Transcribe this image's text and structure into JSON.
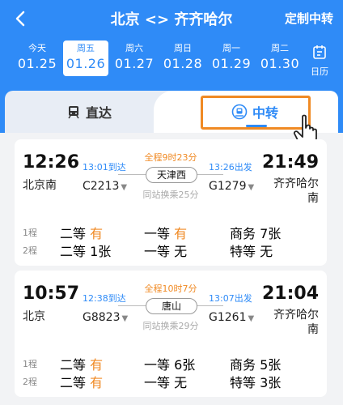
{
  "header": {
    "title": "北京 <> 齐齐哈尔",
    "custom_label": "定制中转",
    "calendar_label": "日历"
  },
  "dates": [
    {
      "weekday": "今天",
      "date": "01.25"
    },
    {
      "weekday": "周五",
      "date": "01.26",
      "selected": true
    },
    {
      "weekday": "周六",
      "date": "01.27"
    },
    {
      "weekday": "周日",
      "date": "01.28"
    },
    {
      "weekday": "周一",
      "date": "01.29"
    },
    {
      "weekday": "周二",
      "date": "01.30"
    }
  ],
  "tabs": {
    "direct": "直达",
    "transfer": "中转"
  },
  "trips": [
    {
      "dep_time": "12:26",
      "dep_station": "北京南",
      "arr_time": "21:49",
      "arr_station": "齐齐哈尔南",
      "first_arrive": "13:01到达",
      "second_depart": "13:26出发",
      "duration": "全程9时23分",
      "transfer_station": "天津西",
      "train1": "C2213",
      "train2": "G1279",
      "transfer_note": "同站换乘25分",
      "seats": [
        {
          "leg": "1程",
          "s1_label": "二等",
          "s1_val": "有",
          "s2_label": "一等",
          "s2_val": "有",
          "s3": "商务 7张"
        },
        {
          "leg": "2程",
          "s1_label": "二等",
          "s1_val": "1张",
          "s2_label": "一等",
          "s2_val": "无",
          "s3": "特等 无"
        }
      ]
    },
    {
      "dep_time": "10:57",
      "dep_station": "北京",
      "arr_time": "21:04",
      "arr_station": "齐齐哈尔南",
      "first_arrive": "12:38到达",
      "second_depart": "13:07出发",
      "duration": "全程10时7分",
      "transfer_station": "唐山",
      "train1": "G8823",
      "train2": "G1261",
      "transfer_note": "同站换乘29分",
      "seats": [
        {
          "leg": "1程",
          "s1_label": "二等",
          "s1_val": "有",
          "s2_label": "一等",
          "s2_val": "6张",
          "s3": "商务 5张"
        },
        {
          "leg": "2程",
          "s1_label": "二等",
          "s1_val": "有",
          "s2_label": "一等",
          "s2_val": "无",
          "s3": "特等 3张"
        }
      ]
    }
  ],
  "colors": {
    "primary": "#2f8bf7",
    "accent": "#f08a24"
  }
}
